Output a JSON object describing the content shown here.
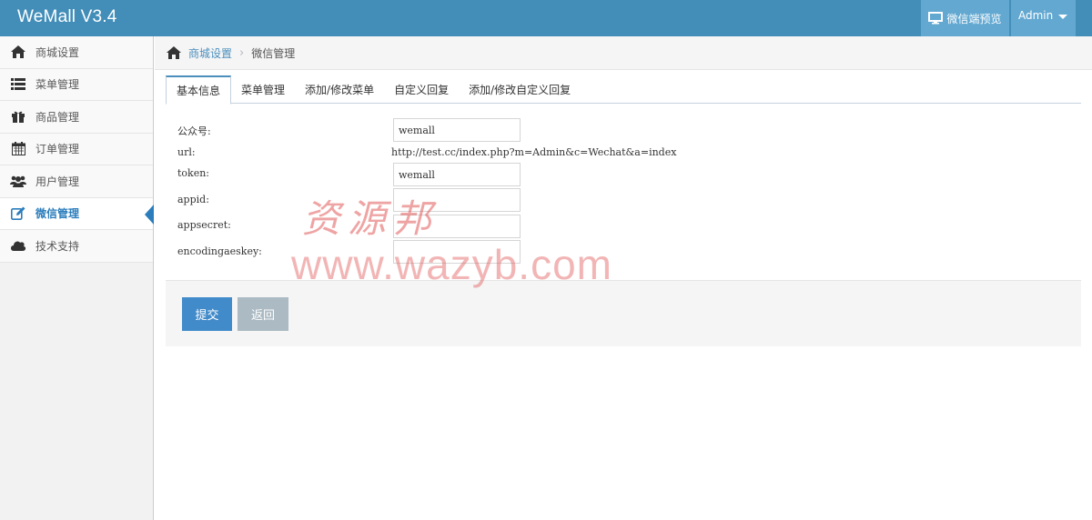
{
  "app": {
    "title": "WeMall V3.4"
  },
  "navbar": {
    "preview_label": "微信端预览",
    "preview_icon": "desktop-icon",
    "user_label": "Admin",
    "colors": {
      "bar": "#438eb9",
      "button": "#62a8d1"
    }
  },
  "sidebar": {
    "items": [
      {
        "label": "商城设置",
        "icon": "home-icon"
      },
      {
        "label": "菜单管理",
        "icon": "list-icon"
      },
      {
        "label": "商品管理",
        "icon": "gift-icon"
      },
      {
        "label": "订单管理",
        "icon": "calendar-icon"
      },
      {
        "label": "用户管理",
        "icon": "users-icon"
      },
      {
        "label": "微信管理",
        "icon": "edit-icon",
        "active": true
      },
      {
        "label": "技术支持",
        "icon": "cloud-icon"
      }
    ]
  },
  "breadcrumb": {
    "home_icon": "home-icon",
    "link": "商城设置",
    "current": "微信管理"
  },
  "tabs": [
    {
      "label": "基本信息",
      "active": true
    },
    {
      "label": "菜单管理"
    },
    {
      "label": "添加/修改菜单"
    },
    {
      "label": "自定义回复"
    },
    {
      "label": "添加/修改自定义回复"
    }
  ],
  "form": {
    "public_account": {
      "label": "公众号:",
      "value": "wemall"
    },
    "url": {
      "label": "url:",
      "value": "http://test.cc/index.php?m=Admin&c=Wechat&a=index"
    },
    "token": {
      "label": "token:",
      "value": "wemall"
    },
    "appid": {
      "label": "appid:",
      "value": ""
    },
    "appsecret": {
      "label": "appsecret:",
      "value": ""
    },
    "encodingaeskey": {
      "label": "encodingaeskey:",
      "value": ""
    }
  },
  "actions": {
    "submit": "提交",
    "back": "返回"
  },
  "watermark": {
    "cn": "资源邦",
    "url": "www.wazyb.com"
  }
}
